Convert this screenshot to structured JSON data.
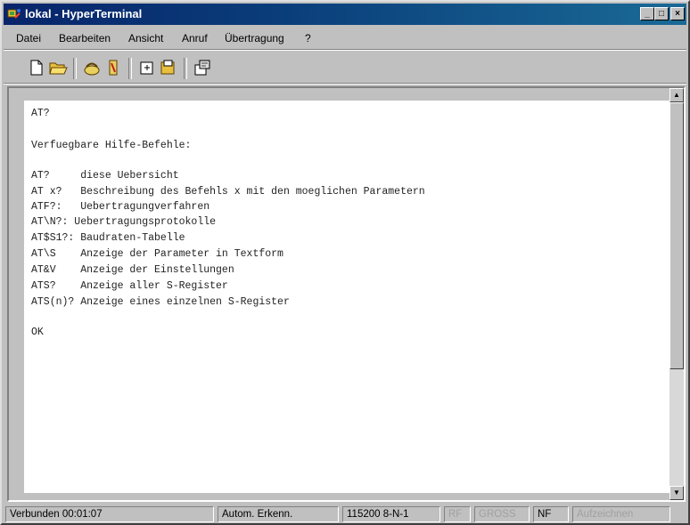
{
  "window": {
    "title": "lokal - HyperTerminal",
    "minimize": "_",
    "maximize": "□",
    "close": "×"
  },
  "menu": {
    "items": [
      "Datei",
      "Bearbeiten",
      "Ansicht",
      "Anruf",
      "Übertragung",
      "?"
    ]
  },
  "toolbar": {
    "icons": [
      "new-icon",
      "open-icon",
      "connect-icon",
      "disconnect-icon",
      "send-icon",
      "receive-icon",
      "properties-icon"
    ]
  },
  "terminal": {
    "lines": [
      "AT?",
      "",
      "Verfuegbare Hilfe-Befehle:",
      "",
      "AT?     diese Uebersicht",
      "AT x?   Beschreibung des Befehls x mit den moeglichen Parametern",
      "ATF?:   Uebertragungverfahren",
      "AT\\N?: Uebertragungsprotokolle",
      "AT$S1?: Baudraten-Tabelle",
      "AT\\S    Anzeige der Parameter in Textform",
      "AT&V    Anzeige der Einstellungen",
      "ATS?    Anzeige aller S-Register",
      "ATS(n)? Anzeige eines einzelnen S-Register",
      "",
      "OK"
    ]
  },
  "scrollbar": {
    "up": "▲",
    "down": "▼"
  },
  "status": {
    "connected": "Verbunden 00:01:07",
    "detect": "Autom. Erkenn.",
    "settings": "115200 8-N-1",
    "rf": "RF",
    "gross": "GROSS",
    "nf": "NF",
    "record": "Aufzeichnen"
  },
  "colors": {
    "titlebar_start": "#08246b",
    "titlebar_end": "#1a6a96",
    "chrome": "#c0c0c0"
  }
}
